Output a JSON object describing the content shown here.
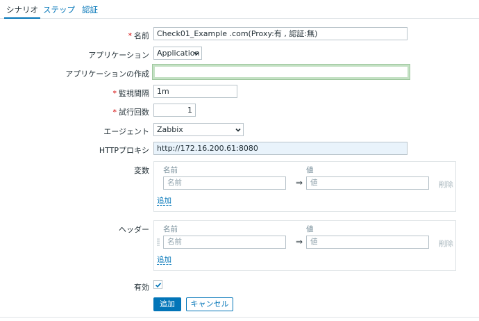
{
  "tabs": [
    {
      "label": "シナリオ",
      "active": true
    },
    {
      "label": "ステップ",
      "active": false
    },
    {
      "label": "認証",
      "active": false
    }
  ],
  "form": {
    "name": {
      "label": "名前",
      "value": "Check01_Example .com(Proxy:有 , 認証:無)"
    },
    "application": {
      "label": "アプリケーション",
      "value": "Application"
    },
    "new_application": {
      "label": "アプリケーションの作成",
      "value": ""
    },
    "interval": {
      "label": "監視間隔",
      "value": "1m"
    },
    "attempts": {
      "label": "試行回数",
      "value": "1"
    },
    "agent": {
      "label": "エージェント",
      "value": "Zabbix"
    },
    "http_proxy": {
      "label": "HTTPプロキシ",
      "value": "http://172.16.200.61:8080"
    },
    "variables": {
      "label": "変数",
      "col_name": "名前",
      "col_value": "値",
      "name_placeholder": "名前",
      "value_placeholder": "値",
      "arrow": "⇒",
      "remove_label": "削除",
      "add_label": "追加"
    },
    "headers": {
      "label": "ヘッダー",
      "col_name": "名前",
      "col_value": "値",
      "name_placeholder": "名前",
      "value_placeholder": "値",
      "arrow": "⇒",
      "remove_label": "削除",
      "add_label": "追加"
    },
    "enabled": {
      "label": "有効",
      "checked": true
    },
    "required_mark": "*"
  },
  "buttons": {
    "add": "追加",
    "cancel": "キャンセル"
  },
  "colors": {
    "accent": "#0275b8",
    "required": "#d40000",
    "focus_border": "#c4e1c4"
  }
}
